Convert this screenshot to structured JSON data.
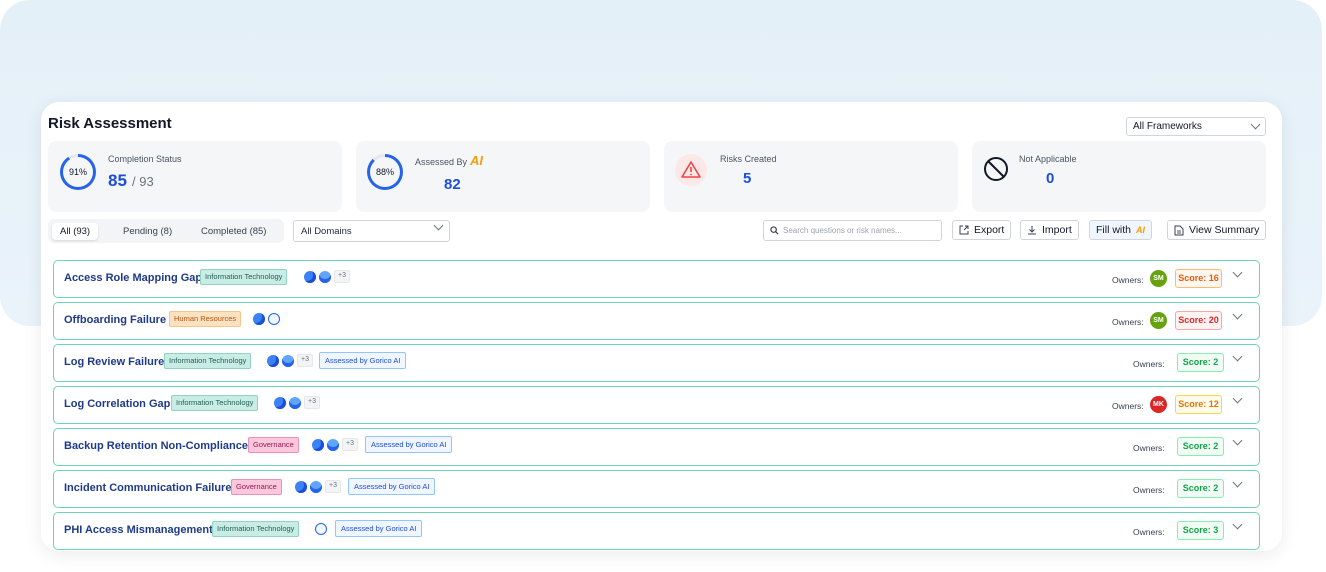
{
  "header": {
    "title": "Risk Assessment",
    "framework_select": "All Frameworks"
  },
  "stats": {
    "completion": {
      "label": "Completion Status",
      "percent_label": "91%",
      "percent": 91,
      "done": "85",
      "total": "/ 93"
    },
    "assessed": {
      "label": "Assessed By",
      "ai_mark": "AI",
      "percent_label": "88%",
      "percent": 88,
      "value": "82"
    },
    "risks": {
      "label": "Risks Created",
      "value": "5"
    },
    "na": {
      "label": "Not Applicable",
      "value": "0"
    }
  },
  "tabs": [
    {
      "label": "All (93)"
    },
    {
      "label": "Pending (8)"
    },
    {
      "label": "Completed (85)"
    }
  ],
  "domain_select": "All Domains",
  "search": {
    "placeholder": "Search questions or risk names..."
  },
  "toolbar": {
    "export": "Export",
    "import": "Import",
    "fill": "Fill with",
    "fill_ai": "AI",
    "summary": "View Summary"
  },
  "owners_label": "Owners:",
  "rows": [
    {
      "name": "Access Role Mapping Gap",
      "badge": "Information Technology",
      "plus": "+3",
      "ai": "",
      "owner": "SM",
      "score": "Score: 16"
    },
    {
      "name": "Offboarding Failure",
      "badge": "Human Resources",
      "plus": "",
      "ai": "",
      "owner": "SM",
      "score": "Score: 20"
    },
    {
      "name": "Log Review Failure",
      "badge": "Information Technology",
      "plus": "+3",
      "ai": "Assessed by Gorico AI",
      "owner": "",
      "score": "Score: 2"
    },
    {
      "name": "Log Correlation Gap",
      "badge": "Information Technology",
      "plus": "+3",
      "ai": "",
      "owner": "MK",
      "score": "Score: 12"
    },
    {
      "name": "Backup Retention Non-Compliance",
      "badge": "Governance",
      "plus": "+3",
      "ai": "Assessed by Gorico AI",
      "owner": "",
      "score": "Score: 2"
    },
    {
      "name": "Incident Communication Failure",
      "badge": "Governance",
      "plus": "+3",
      "ai": "Assessed by Gorico AI",
      "owner": "",
      "score": "Score: 2"
    },
    {
      "name": "PHI Access Mismanagement",
      "badge": "Information Technology",
      "plus": "",
      "ai": "Assessed by Gorico AI",
      "owner": "",
      "score": "Score: 3"
    }
  ],
  "colors": {
    "accent": "#1d4ed8",
    "row_border": "#6ed3b1",
    "ring": "#2563eb",
    "warn": "#ef4444"
  }
}
